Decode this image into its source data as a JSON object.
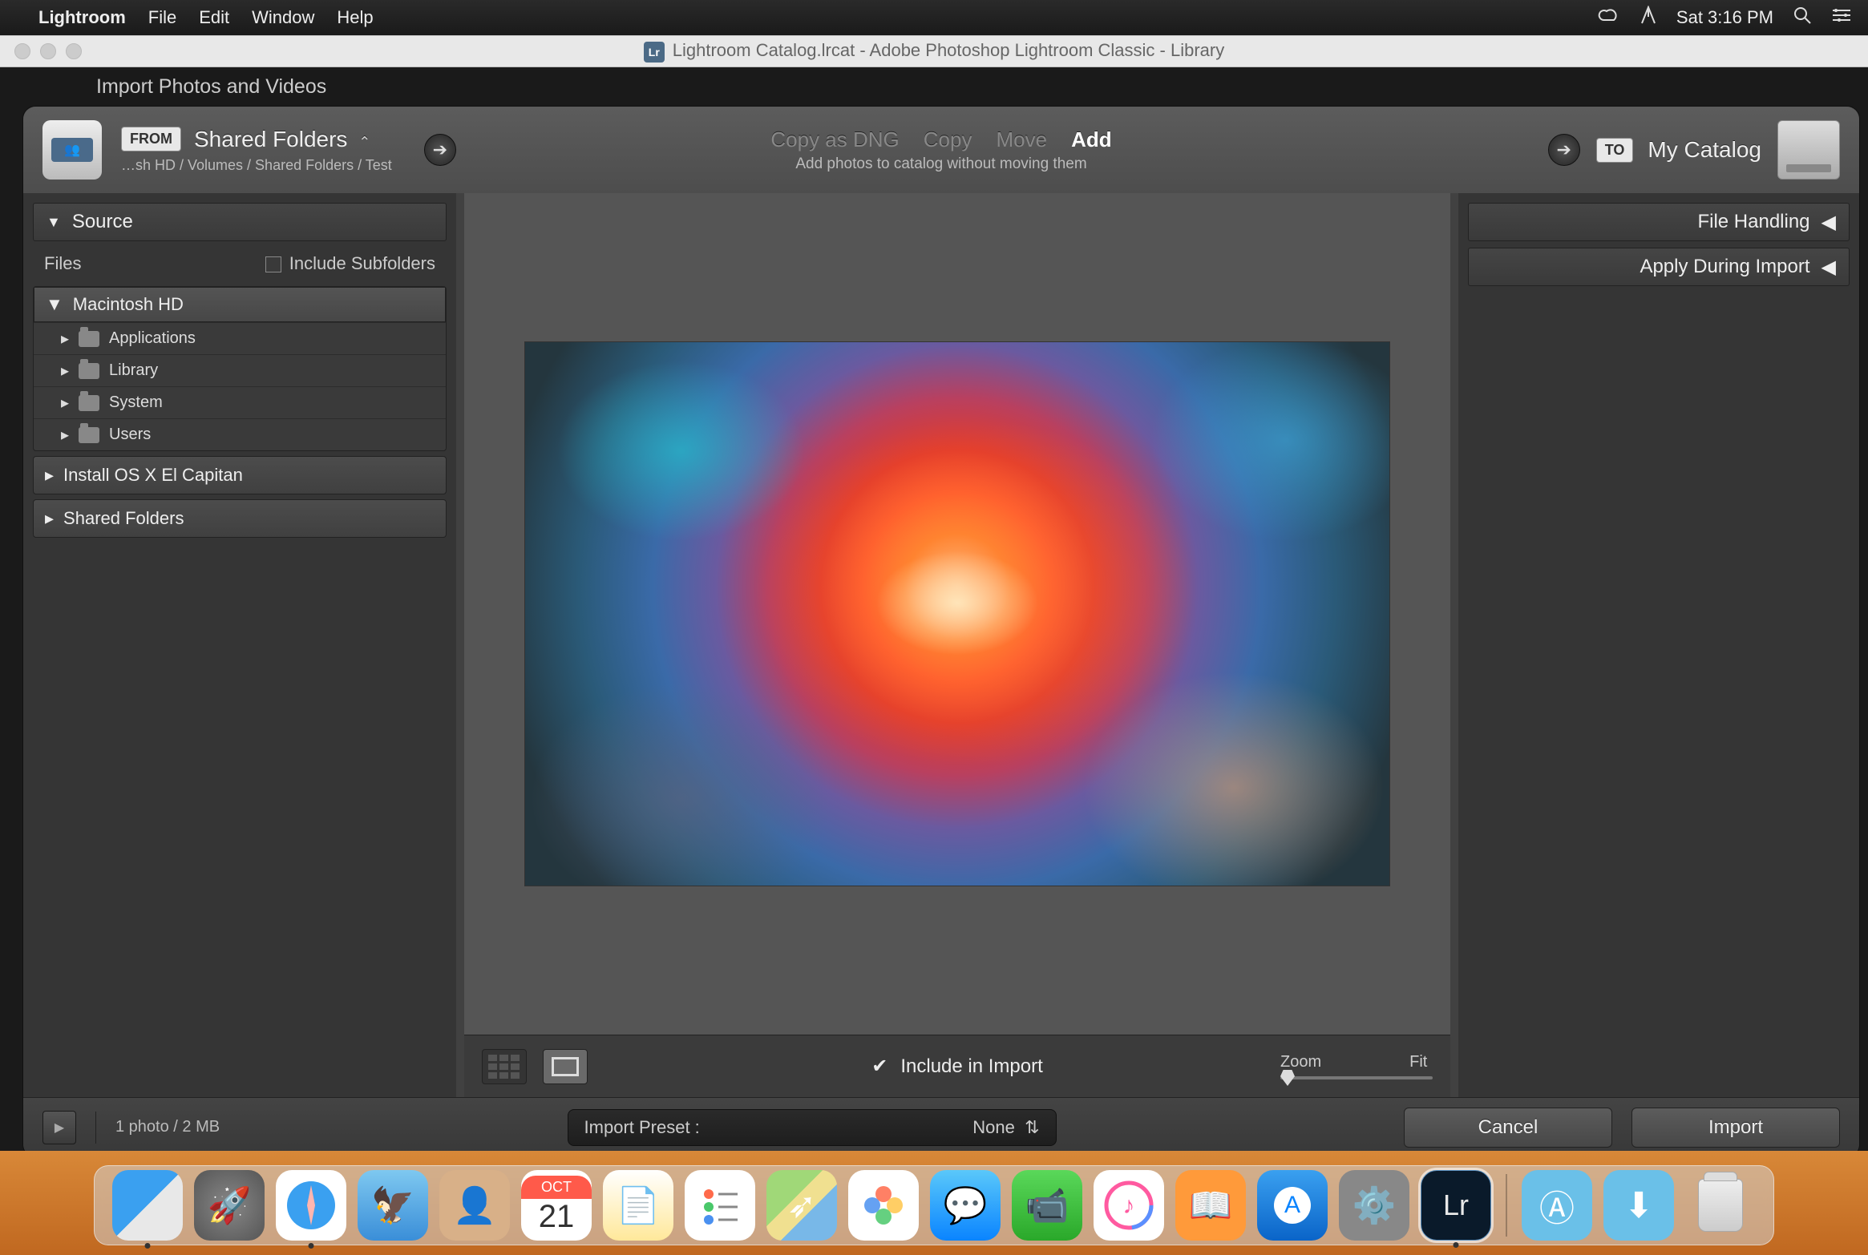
{
  "menubar": {
    "app": "Lightroom",
    "items": [
      "File",
      "Edit",
      "Window",
      "Help"
    ],
    "clock": "Sat 3:16 PM"
  },
  "window": {
    "title": "Lightroom Catalog.lrcat - Adobe Photoshop Lightroom Classic - Library"
  },
  "behind_title": "Import Photos and Videos",
  "import": {
    "from_badge": "FROM",
    "from_name": "Shared Folders",
    "from_path": "…sh HD / Volumes / Shared Folders / Test",
    "modes": {
      "dng": "Copy as DNG",
      "copy": "Copy",
      "move": "Move",
      "add": "Add"
    },
    "mode_sub": "Add photos to catalog without moving them",
    "to_badge": "TO",
    "to_name": "My Catalog"
  },
  "left": {
    "header": "Source",
    "files_label": "Files",
    "include_subfolders": "Include Subfolders",
    "root": "Macintosh HD",
    "children": [
      "Applications",
      "Library",
      "System",
      "Users"
    ],
    "vol1": "Install OS X El Capitan",
    "vol2": "Shared Folders"
  },
  "right": {
    "file_handling": "File Handling",
    "apply_during": "Apply During Import"
  },
  "toolbar": {
    "include_label": "Include in Import",
    "zoom": "Zoom",
    "fit": "Fit"
  },
  "bottom": {
    "count": "1 photo / 2 MB",
    "preset_label": "Import Preset :",
    "preset_value": "None",
    "cancel": "Cancel",
    "import": "Import"
  },
  "dock": {
    "cal_month": "OCT",
    "cal_day": "21",
    "lr": "Lr"
  }
}
